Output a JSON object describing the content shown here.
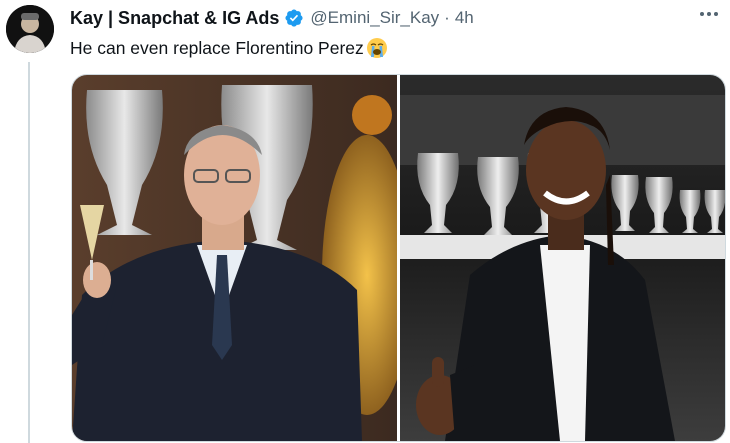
{
  "tweet": {
    "author_name": "Kay | Snapchat & IG Ads",
    "handle": "@Emini_Sir_Kay",
    "separator": "·",
    "timestamp": "4h",
    "text": "He can even replace Florentino Perez",
    "emoji": "loudly-crying-face"
  },
  "icons": {
    "verified": "verified-badge-icon",
    "more": "more-options-icon"
  },
  "media": {
    "images": [
      {
        "name": "florentino-perez-photo"
      },
      {
        "name": "camavinga-photo"
      }
    ]
  },
  "colors": {
    "verified_blue": "#1d9bf0",
    "secondary_text": "#536471",
    "thread_line": "#cfd9de"
  }
}
